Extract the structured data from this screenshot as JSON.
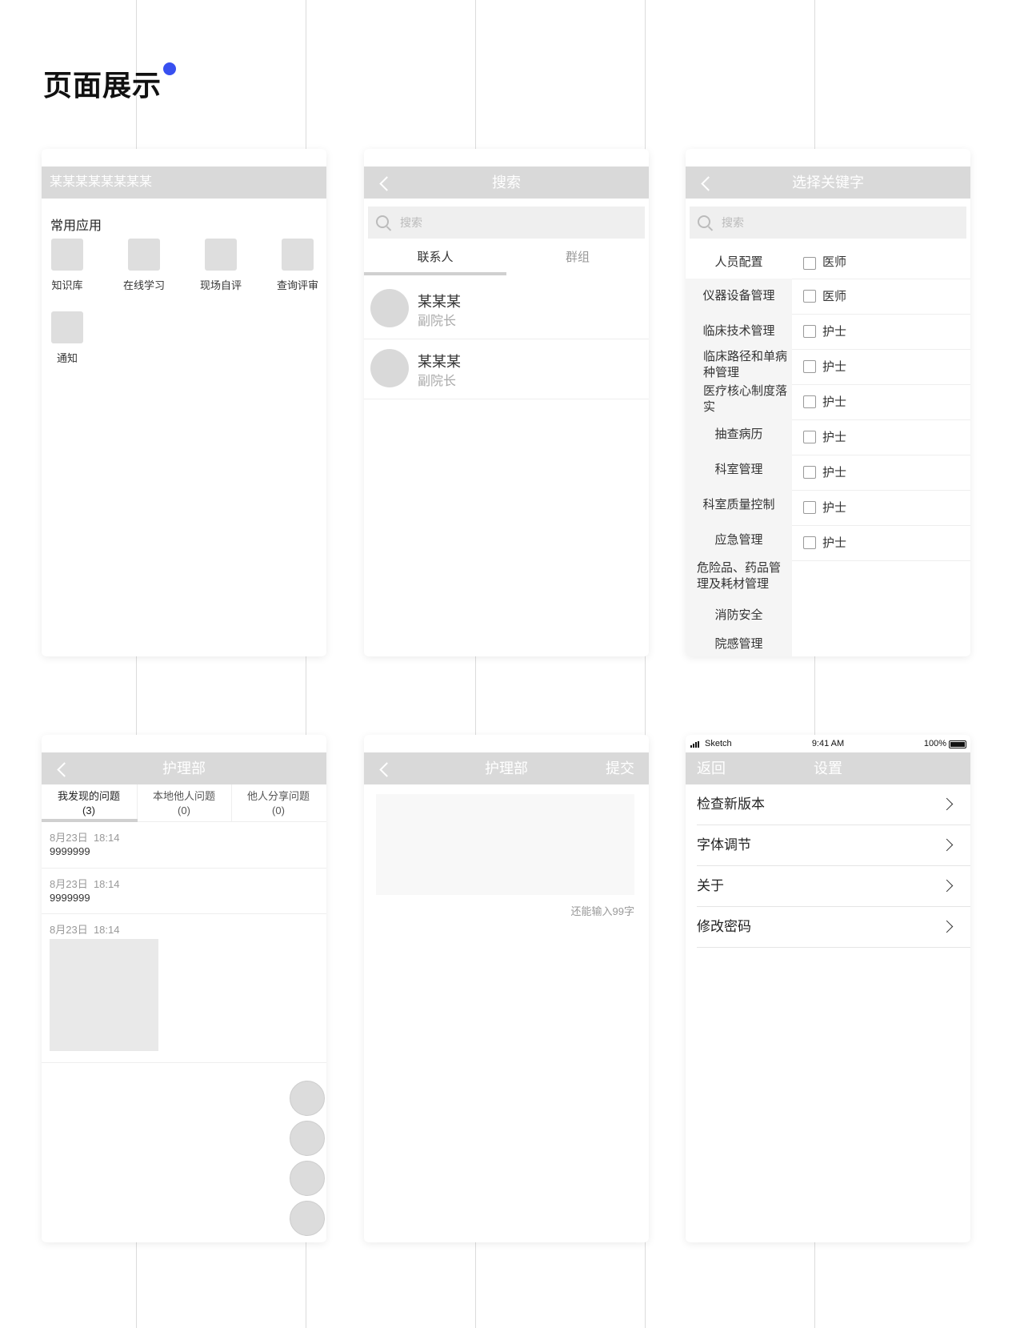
{
  "page_title": "页面展示",
  "accent_color": "#3850f0",
  "screen1": {
    "header_title": "某某某某某某某某",
    "section_label": "常用应用",
    "apps": [
      "知识库",
      "在线学习",
      "现场自评",
      "查询评审",
      "通知"
    ]
  },
  "screen2": {
    "title": "搜索",
    "search_placeholder": "搜索",
    "tabs": [
      "联系人",
      "群组"
    ],
    "contacts": [
      {
        "name": "某某某",
        "role": "副院长"
      },
      {
        "name": "某某某",
        "role": "副院长"
      }
    ]
  },
  "screen3": {
    "title": "选择关键字",
    "search_placeholder": "搜索",
    "categories": [
      "人员配置",
      "仪器设备管理",
      "临床技术管理",
      "临床路径和单病种管理",
      "医疗核心制度落实",
      "抽查病历",
      "科室管理",
      "科室质量控制",
      "应急管理",
      "危险品、药品管理及耗材管理",
      "消防安全",
      "院感管理"
    ],
    "options": [
      "医师",
      "医师",
      "护士",
      "护士",
      "护士",
      "护士",
      "护士",
      "护士",
      "护士"
    ]
  },
  "screen4": {
    "title": "护理部",
    "tabs": [
      {
        "label": "我发现的问题",
        "count": "(3)"
      },
      {
        "label": "本地他人问题",
        "count": "(0)"
      },
      {
        "label": "他人分享问题",
        "count": "(0)"
      }
    ],
    "issues": [
      {
        "date": "8月23日",
        "time": "18:14",
        "text": "9999999"
      },
      {
        "date": "8月23日",
        "time": "18:14",
        "text": "9999999"
      },
      {
        "date": "8月23日",
        "time": "18:14",
        "text": ""
      }
    ]
  },
  "screen5": {
    "title": "护理部",
    "submit": "提交",
    "remaining": "还能输入99字"
  },
  "screen6": {
    "status": {
      "carrier": "Sketch",
      "time": "9:41 AM",
      "battery": "100%"
    },
    "back": "返回",
    "title": "设置",
    "items": [
      "检查新版本",
      "字体调节",
      "关于",
      "修改密码"
    ]
  }
}
